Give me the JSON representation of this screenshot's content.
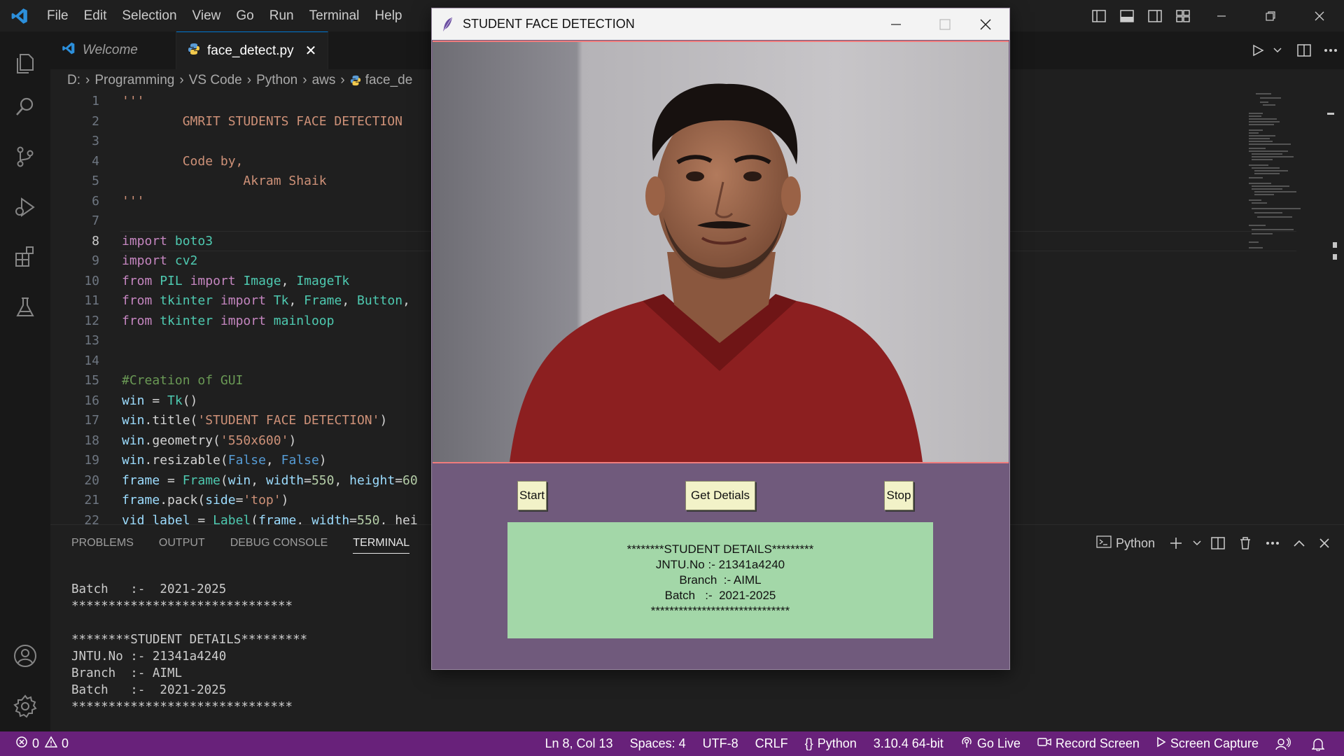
{
  "menu": [
    "File",
    "Edit",
    "Selection",
    "View",
    "Go",
    "Run",
    "Terminal",
    "Help"
  ],
  "tabs": [
    {
      "label": "Welcome",
      "active": false
    },
    {
      "label": "face_detect.py",
      "active": true
    }
  ],
  "breadcrumb": [
    "D:",
    "Programming",
    "VS Code",
    "Python",
    "aws",
    "face_de"
  ],
  "editor": {
    "current_line": 8,
    "lines": [
      {
        "n": "1",
        "text": "'''"
      },
      {
        "n": "2",
        "text": "        GMRIT STUDENTS FACE DETECTION"
      },
      {
        "n": "3",
        "text": ""
      },
      {
        "n": "4",
        "text": "        Code by,"
      },
      {
        "n": "5",
        "text": "                Akram Shaik"
      },
      {
        "n": "6",
        "text": "'''"
      },
      {
        "n": "7",
        "text": ""
      },
      {
        "n": "8",
        "text": "import boto3"
      },
      {
        "n": "9",
        "text": "import cv2"
      },
      {
        "n": "10",
        "text": "from PIL import Image, ImageTk"
      },
      {
        "n": "11",
        "text": "from tkinter import Tk, Frame, Button,"
      },
      {
        "n": "12",
        "text": "from tkinter import mainloop"
      },
      {
        "n": "13",
        "text": ""
      },
      {
        "n": "14",
        "text": ""
      },
      {
        "n": "15",
        "text": "#Creation of GUI"
      },
      {
        "n": "16",
        "text": "win = Tk()"
      },
      {
        "n": "17",
        "text": "win.title('STUDENT FACE DETECTION')"
      },
      {
        "n": "18",
        "text": "win.geometry('550x600')"
      },
      {
        "n": "19",
        "text": "win.resizable(False, False)"
      },
      {
        "n": "20",
        "text": "frame = Frame(win, width=550, height=60"
      },
      {
        "n": "21",
        "text": "frame.pack(side='top')"
      },
      {
        "n": "22",
        "text": "vid_label = Label(frame, width=550, hei"
      }
    ]
  },
  "panel": {
    "tabs": [
      "PROBLEMS",
      "OUTPUT",
      "DEBUG CONSOLE",
      "TERMINAL"
    ],
    "active_tab": "TERMINAL",
    "shell_label": "Python",
    "terminal_lines": [
      "Batch   :-  2021-2025",
      "******************************",
      "",
      "********STUDENT DETAILS*********",
      "JNTU.No :- 21341a4240",
      "Branch  :- AIML",
      "Batch   :-  2021-2025",
      "******************************"
    ]
  },
  "statusbar": {
    "errors": "0",
    "warnings": "0",
    "position": "Ln 8, Col 13",
    "spaces": "Spaces: 4",
    "encoding": "UTF-8",
    "eol": "CRLF",
    "language": "Python",
    "interpreter": "3.10.4 64-bit",
    "go_live": "Go Live",
    "record": "Record Screen",
    "capture": "Screen Capture",
    "color": "#68217a"
  },
  "tk_window": {
    "title": "STUDENT FACE DETECTION",
    "buttons": {
      "start": "Start",
      "get_details": "Get Detials",
      "stop": "Stop"
    },
    "details": [
      "********STUDENT DETAILS*********",
      "JNTU.No :- 21341a4240",
      "Branch  :- AIML",
      "Batch   :-  2021-2025",
      "******************************"
    ],
    "bg_color": "#705a7c",
    "details_bg": "#a3d7a8"
  }
}
